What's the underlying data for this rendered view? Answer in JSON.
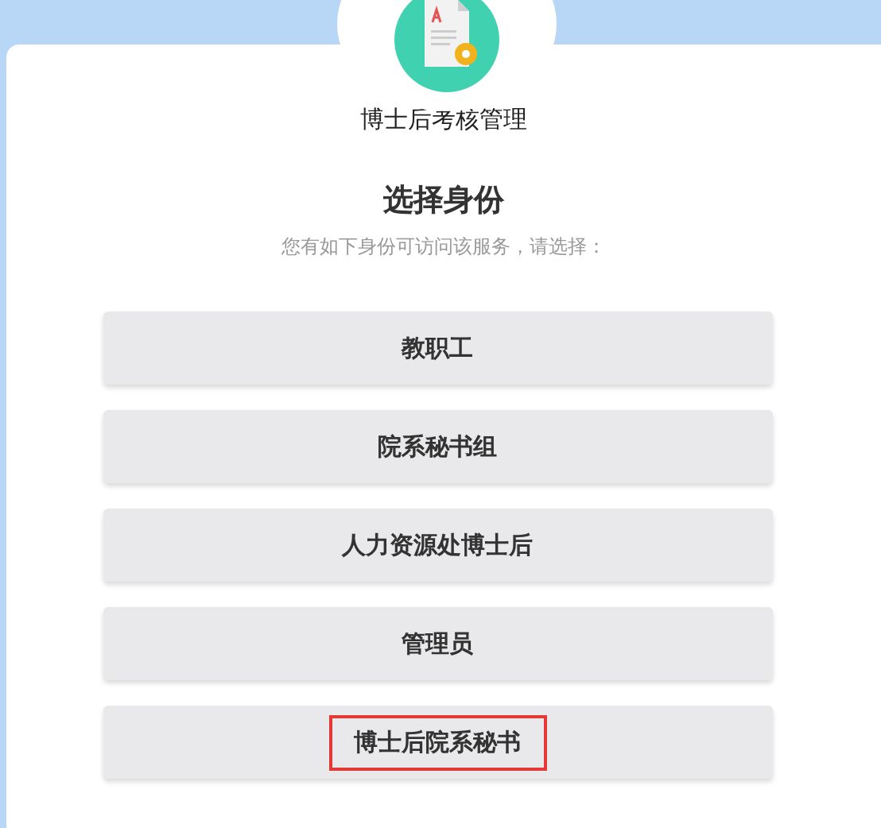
{
  "app": {
    "title": "博士后考核管理"
  },
  "heading": "选择身份",
  "subtitle": "您有如下身份可访问该服务，请选择：",
  "roles": [
    {
      "label": "教职工",
      "highlighted": false
    },
    {
      "label": "院系秘书组",
      "highlighted": false
    },
    {
      "label": "人力资源处博士后",
      "highlighted": false
    },
    {
      "label": "管理员",
      "highlighted": false
    },
    {
      "label": "博士后院系秘书",
      "highlighted": true
    }
  ]
}
